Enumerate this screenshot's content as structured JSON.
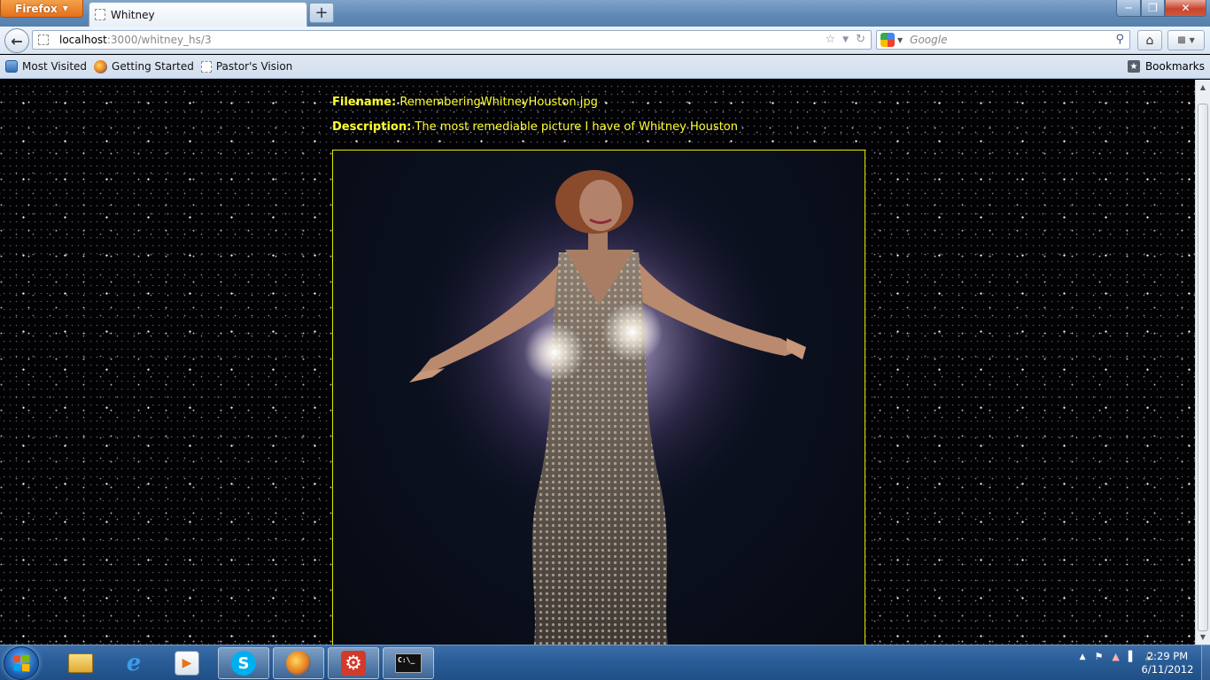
{
  "browser": {
    "menu_button_label": "Firefox",
    "tab_title": "Whitney",
    "url_host": "localhost",
    "url_path": ":3000/whitney_hs/3",
    "search_engine_icon": "google-icon",
    "search_placeholder": "Google",
    "bookmarks": [
      {
        "label": "Most Visited",
        "icon": "most-visited-icon"
      },
      {
        "label": "Getting Started",
        "icon": "firefox-icon"
      },
      {
        "label": "Pastor's Vision",
        "icon": "page-icon"
      }
    ],
    "bookmarks_menu_label": "Bookmarks"
  },
  "page": {
    "filename_label": "Filename:",
    "filename_value": "RememberingWhitneyHouston.jpg",
    "description_label": "Description:",
    "description_value": "The most remediable picture I have of Whitney Houston",
    "text_color": "#ffff33",
    "frame_color": "#e6e600"
  },
  "taskbar": {
    "apps": [
      {
        "name": "windows-explorer",
        "icon": "folder-icon"
      },
      {
        "name": "internet-explorer",
        "icon": "ie-icon"
      },
      {
        "name": "media-player",
        "icon": "media-player-icon"
      },
      {
        "name": "skype",
        "icon": "skype-icon"
      },
      {
        "name": "firefox",
        "icon": "firefox-icon",
        "active": true
      },
      {
        "name": "settings-app",
        "icon": "gear-icon"
      },
      {
        "name": "command-prompt",
        "icon": "terminal-icon"
      }
    ],
    "clock_time": "2:29 PM",
    "clock_date": "6/11/2012"
  }
}
